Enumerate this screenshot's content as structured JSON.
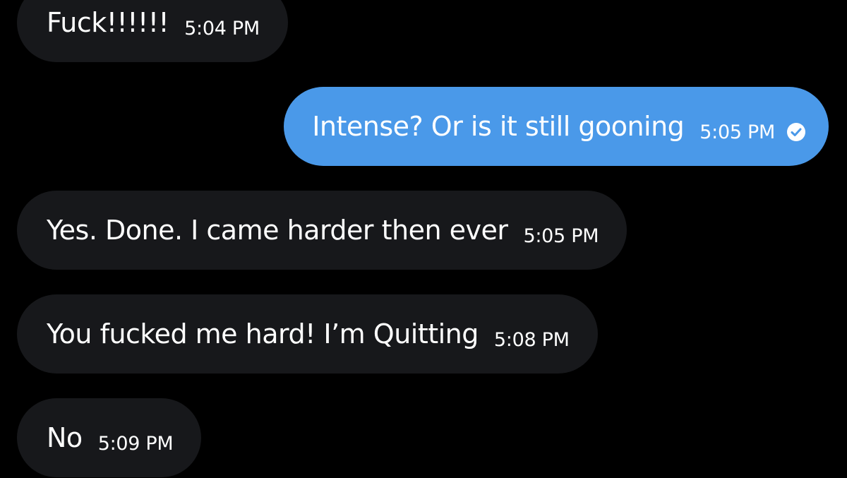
{
  "conversation": {
    "messages": [
      {
        "direction": "received",
        "text": "Fuck!!!!!!",
        "time": "5:04 PM"
      },
      {
        "direction": "sent",
        "text": "Intense? Or is it still gooning",
        "time": "5:05 PM",
        "status_icon": "read-check-icon"
      },
      {
        "direction": "received",
        "text": "Yes. Done. I came harder then ever",
        "time": "5:05 PM"
      },
      {
        "direction": "received",
        "text": "You fucked me hard! I’m Quitting",
        "time": "5:08 PM"
      },
      {
        "direction": "received",
        "text": "No",
        "time": "5:09 PM"
      }
    ]
  },
  "colors": {
    "background": "#000000",
    "received_bubble": "#17181b",
    "sent_bubble": "#4a99e9",
    "text": "#ffffff"
  }
}
